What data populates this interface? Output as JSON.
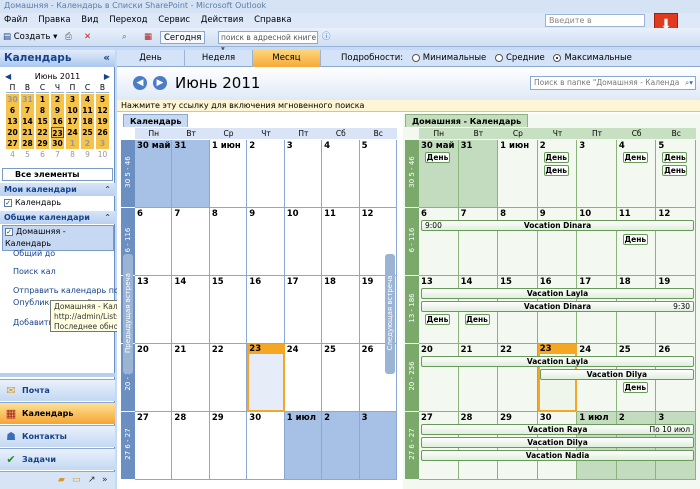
{
  "window": {
    "title": "Домашняя - Календарь в Списки SharePoint - Microsoft Outlook"
  },
  "menu": [
    "Файл",
    "Правка",
    "Вид",
    "Переход",
    "Сервис",
    "Действия",
    "Справка"
  ],
  "help": {
    "placeholder": "Введите в"
  },
  "toolbar": {
    "create": "Создать",
    "today": "Сегодня",
    "address_search": "поиск в адресной книге"
  },
  "nav": {
    "title": "Календарь",
    "collapse": "«",
    "minical": {
      "title": "Июнь 2011",
      "days": [
        "П",
        "В",
        "С",
        "Ч",
        "П",
        "С",
        "В"
      ],
      "rows": [
        [
          "30",
          "31",
          "1",
          "2",
          "3",
          "4",
          "5"
        ],
        [
          "6",
          "7",
          "8",
          "9",
          "10",
          "11",
          "12"
        ],
        [
          "13",
          "14",
          "15",
          "16",
          "17",
          "18",
          "19"
        ],
        [
          "20",
          "21",
          "22",
          "23",
          "24",
          "25",
          "26"
        ],
        [
          "27",
          "28",
          "29",
          "30",
          "1",
          "2",
          "3"
        ],
        [
          "4",
          "5",
          "6",
          "7",
          "8",
          "9",
          "10"
        ]
      ]
    },
    "filter": "Все элементы кале...",
    "my_calendars": "Мои календари",
    "my_items": [
      "Календарь"
    ],
    "shared_calendars": "Общие календари",
    "shared_items": [
      "Домашняя - Календарь"
    ],
    "links": [
      "Общий до",
      "Поиск кал",
      "Отправить календарь по эл",
      "Опубликовать мой календар",
      "Добавить новую группу"
    ],
    "tooltip": [
      "Домашняя - Календарь в Списки SharePoint",
      "http://admin/Lists/List3/",
      "Последнее обновление 10:03"
    ],
    "buttons": [
      "Почта",
      "Календарь",
      "Контакты",
      "Задачи"
    ]
  },
  "views": {
    "day": "День",
    "week": "Неделя",
    "month": "Месяц",
    "details_label": "Подробности:",
    "opt_min": "Минимальные",
    "opt_mid": "Средние",
    "opt_max": "Максимальные"
  },
  "header": {
    "month": "Июнь 2011",
    "search_placeholder": "Поиск в папке \"Домашняя - Календа"
  },
  "infobar": "Нажмите эту ссылку для включения мгновенного поиска",
  "weekdays": [
    "Пн",
    "Вт",
    "Ср",
    "Чт",
    "Пт",
    "Сб",
    "Вс"
  ],
  "week_labels": [
    "30 5 - 46",
    "6 - 116",
    "13 - 186",
    "20 - 256",
    "27 6 - 27"
  ],
  "left_pane": {
    "tab": "Календарь",
    "side_prev": "Предыдущая встреча",
    "side_next": "Следующая встреча",
    "rows": [
      [
        "30 май",
        "31",
        "1 июн",
        "2",
        "3",
        "4",
        "5"
      ],
      [
        "6",
        "7",
        "8",
        "9",
        "10",
        "11",
        "12"
      ],
      [
        "13",
        "14",
        "15",
        "16",
        "17",
        "18",
        "19"
      ],
      [
        "20",
        "21",
        "22",
        "23",
        "24",
        "25",
        "26"
      ],
      [
        "27",
        "28",
        "29",
        "30",
        "1 июл",
        "2",
        "3"
      ]
    ]
  },
  "right_pane": {
    "tab": "Домашняя - Календарь",
    "rows": [
      [
        "30 май",
        "31",
        "1 июн",
        "2",
        "3",
        "4",
        "5"
      ],
      [
        "6",
        "7",
        "8",
        "9",
        "10",
        "11",
        "12"
      ],
      [
        "13",
        "14",
        "15",
        "16",
        "17",
        "18",
        "19"
      ],
      [
        "20",
        "21",
        "22",
        "23",
        "24",
        "25",
        "26"
      ],
      [
        "27",
        "28",
        "29",
        "30",
        "1 июл",
        "2",
        "3"
      ]
    ],
    "events": {
      "day": "День",
      "vac_dinara": "Vocation Dinara",
      "vac_layla": "Vacation Layla",
      "vac_dinara2": "Vacation Dinara",
      "vac_layla2": "Vacation Layla",
      "vac_dilya": "Vacation Dilya",
      "vac_raya": "Vacation Raya",
      "vac_dilya2": "Vacation Dilya",
      "vac_nadia": "Vacation Nadia",
      "time_900": "9:00",
      "time_930": "9:30",
      "to_july": "По 10 июл"
    }
  },
  "colors": {
    "left_cell": "#ffffff",
    "left_other": "#a7c0e6",
    "left_grid": "#8aa8d0",
    "right_cell": "#f3f8f1",
    "right_other": "#c3dcbf",
    "right_grid": "#8ab47a",
    "today": "#f5a623"
  }
}
